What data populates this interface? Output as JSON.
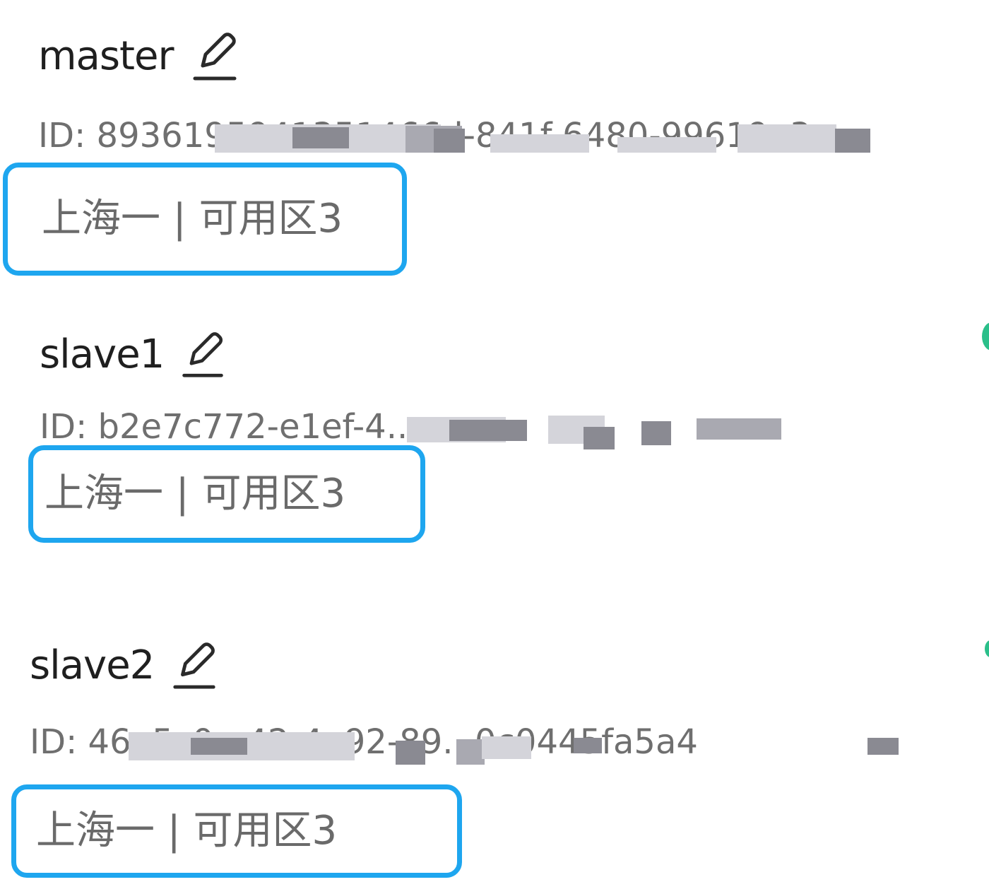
{
  "nodes": [
    {
      "name": "master",
      "id_text": "ID: 8936195941351466d-841f-6480-99619e3c",
      "zone": "上海一 | 可用区3"
    },
    {
      "name": "slave1",
      "id_text": "ID: b2e7c772-e1ef-4...a",
      "zone": "上海一 | 可用区3"
    },
    {
      "name": "slave2",
      "id_text": "ID: 46e5c0...42-4a92-89...0c0445fa5a4",
      "zone": "上海一 | 可用区3"
    }
  ],
  "icons": {
    "edit": "pencil-edit-icon"
  },
  "colors": {
    "highlight_border": "#1ea6ef",
    "status_dot": "#2bbf8a"
  }
}
